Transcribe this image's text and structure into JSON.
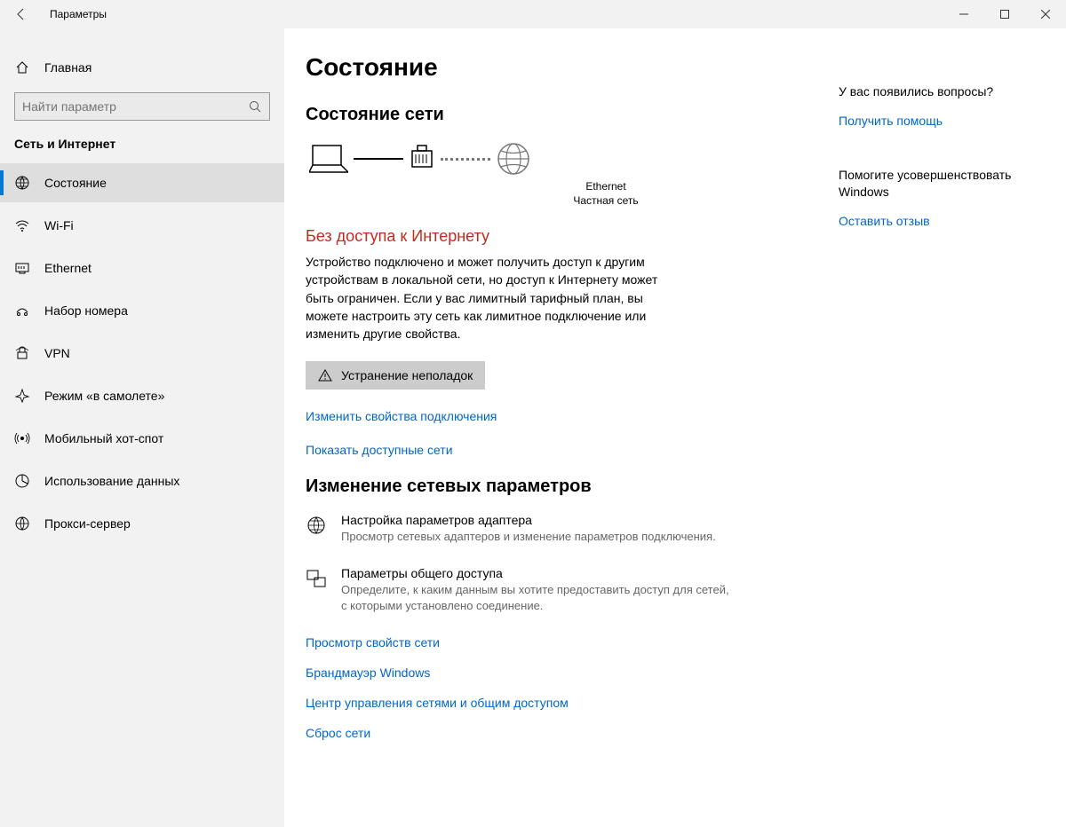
{
  "window": {
    "title": "Параметры"
  },
  "sidebar": {
    "home": "Главная",
    "search_placeholder": "Найти параметр",
    "heading": "Сеть и Интернет",
    "items": [
      {
        "label": "Состояние"
      },
      {
        "label": "Wi-Fi"
      },
      {
        "label": "Ethernet"
      },
      {
        "label": "Набор номера"
      },
      {
        "label": "VPN"
      },
      {
        "label": "Режим «в самолете»"
      },
      {
        "label": "Мобильный хот-спот"
      },
      {
        "label": "Использование данных"
      },
      {
        "label": "Прокси-сервер"
      }
    ]
  },
  "main": {
    "title": "Состояние",
    "section1_heading": "Состояние сети",
    "diagram": {
      "adapter": "Ethernet",
      "network_type": "Частная сеть"
    },
    "status_title": "Без доступа к Интернету",
    "status_desc": "Устройство подключено и может получить доступ к другим устройствам в локальной сети, но доступ к Интернету может быть ограничен. Если у вас лимитный тарифный план, вы можете настроить эту сеть как лимитное подключение или изменить другие свойства.",
    "troubleshoot_btn": "Устранение неполадок",
    "link_change_props": "Изменить свойства подключения",
    "link_show_networks": "Показать доступные сети",
    "section2_heading": "Изменение сетевых параметров",
    "options": [
      {
        "title": "Настройка параметров адаптера",
        "desc": "Просмотр сетевых адаптеров и изменение параметров подключения."
      },
      {
        "title": "Параметры общего доступа",
        "desc": "Определите, к каким данным вы хотите предоставить доступ для сетей, с которыми установлено соединение."
      }
    ],
    "link_view_props": "Просмотр свойств сети",
    "link_firewall": "Брандмауэр Windows",
    "link_sharing_center": "Центр управления сетями и общим доступом",
    "link_reset": "Сброс сети"
  },
  "aside": {
    "q_heading": "У вас появились вопросы?",
    "q_link": "Получить помощь",
    "f_heading": "Помогите усовершенствовать Windows",
    "f_link": "Оставить отзыв"
  }
}
